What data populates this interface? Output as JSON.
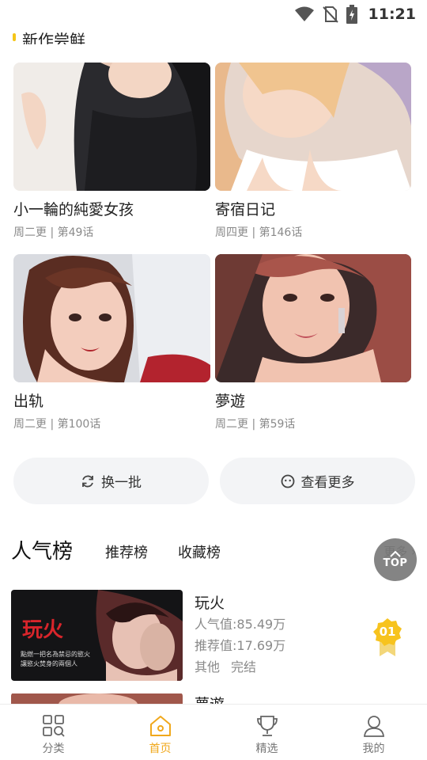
{
  "status_bar": {
    "time": "11:21",
    "icons": [
      "wifi-icon",
      "no-sim-icon",
      "battery-charging-icon"
    ]
  },
  "section": {
    "title": "新作尝鲜"
  },
  "comics": [
    {
      "title": "小一輪的純愛女孩",
      "meta": "周二更 | 第49话"
    },
    {
      "title": "寄宿日记",
      "meta": "周四更 | 第146话"
    },
    {
      "title": "出轨",
      "meta": "周二更 | 第100话"
    },
    {
      "title": "夢遊",
      "meta": "周二更 | 第59话"
    }
  ],
  "actions": {
    "refresh": "换一批",
    "more": "查看更多"
  },
  "ranking": {
    "title": "人气榜",
    "tabs": [
      "推荐榜",
      "收藏榜"
    ],
    "more": "更多",
    "items": [
      {
        "name": "玩火",
        "cover_title": "玩火",
        "cover_sub1": "點燃一把名為禁忌的慾火",
        "cover_sub2": "讓慾火焚身的兩個人",
        "popularity_label": "人气值:",
        "popularity": "85.49万",
        "recommend_label": "推荐值:",
        "recommend": "17.69万",
        "genre": "其他",
        "status": "完结",
        "rank": "01"
      },
      {
        "name": "夢遊"
      }
    ]
  },
  "top_button": {
    "label": "TOP"
  },
  "nav": [
    {
      "label": "分类",
      "icon": "category-grid-icon"
    },
    {
      "label": "首页",
      "icon": "home-icon"
    },
    {
      "label": "精选",
      "icon": "trophy-icon"
    },
    {
      "label": "我的",
      "icon": "user-icon"
    }
  ],
  "colors": {
    "accent": "#f0a81c",
    "medal": "#f7c31e",
    "button_bg": "#f3f4f6"
  }
}
